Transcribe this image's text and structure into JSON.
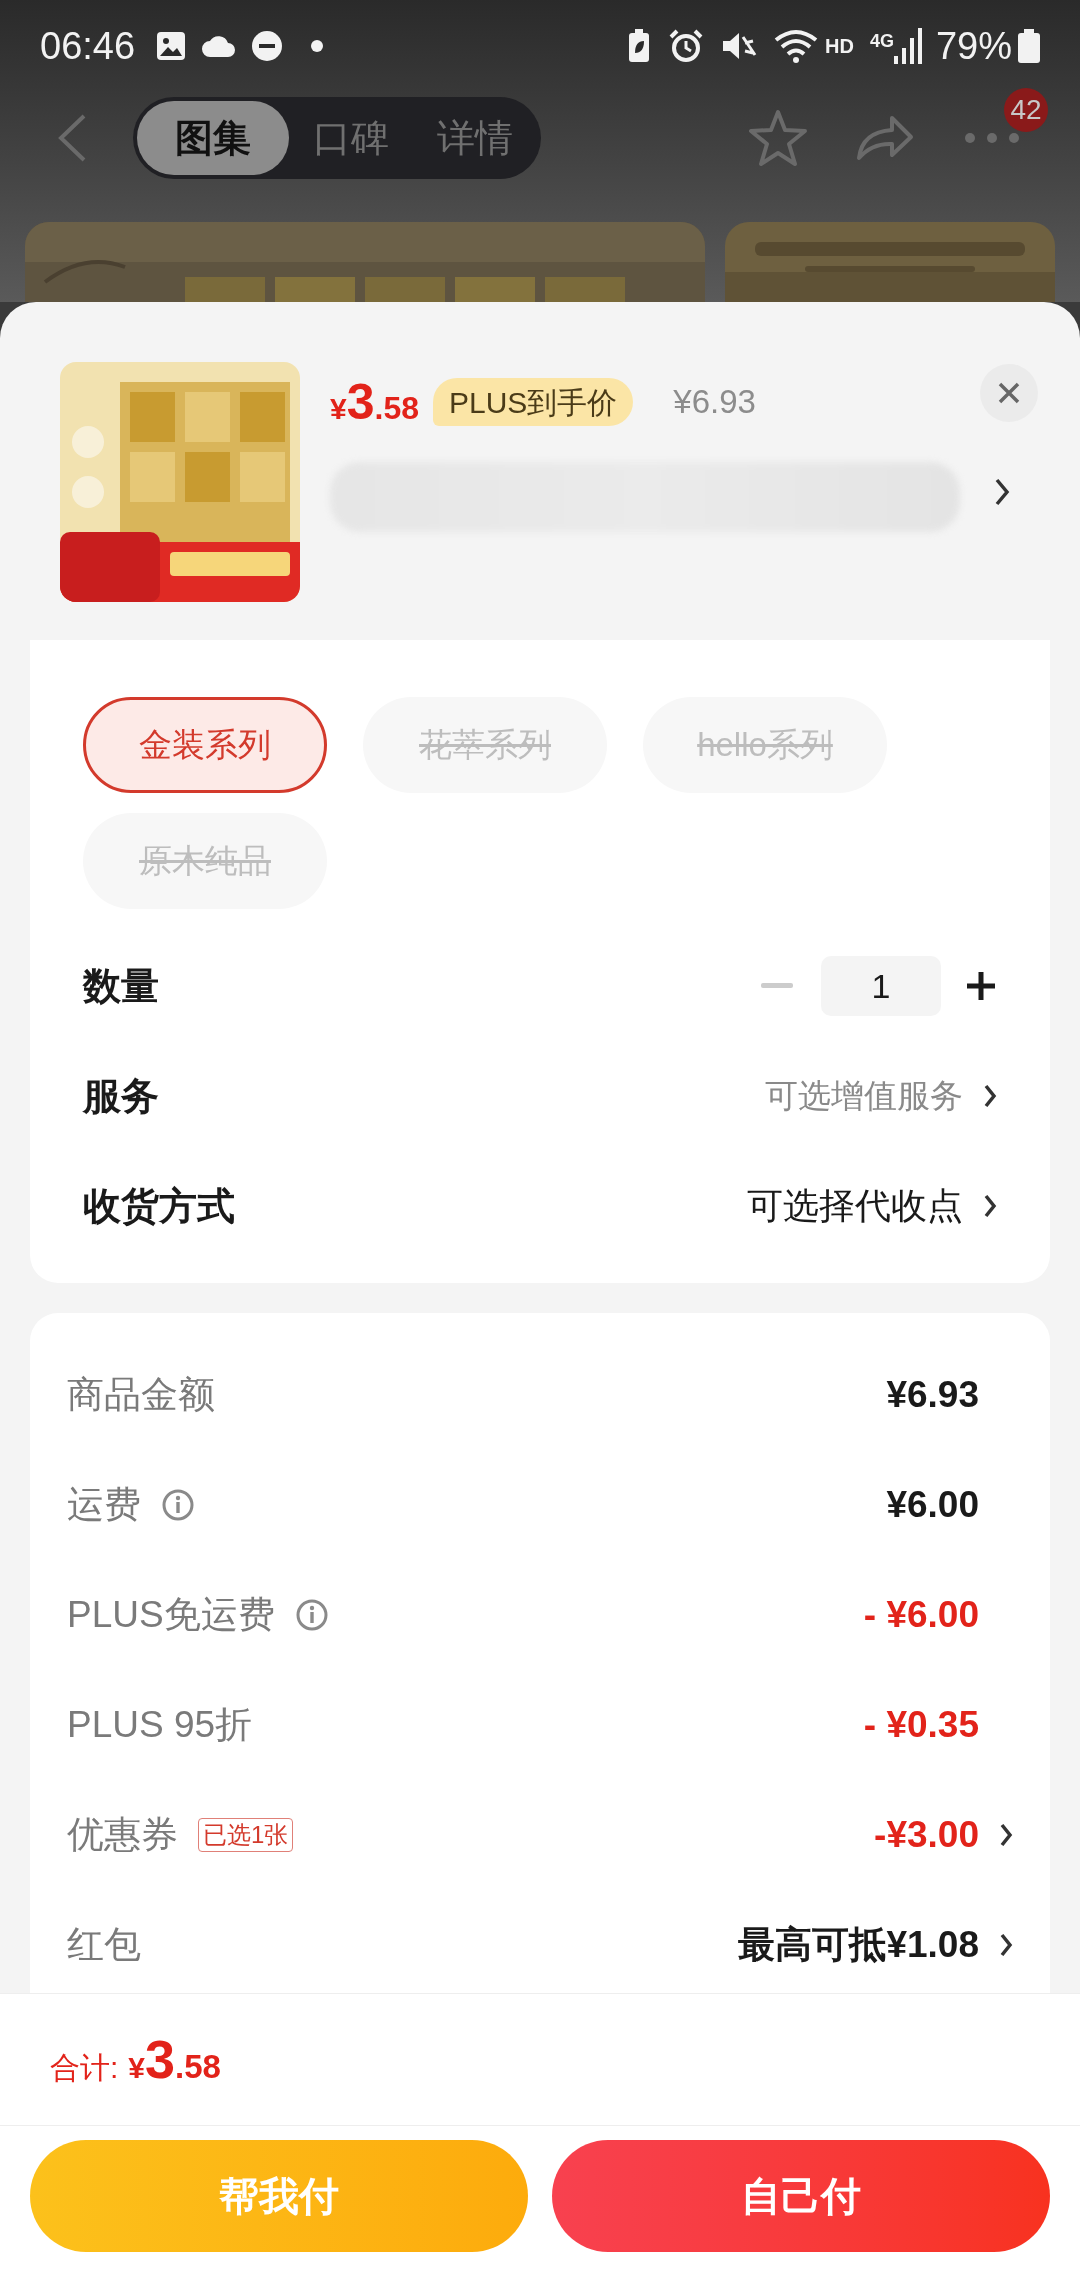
{
  "status_bar": {
    "time": "06:46",
    "network_hd": "HD",
    "network_gen": "4G",
    "battery": "79%"
  },
  "nav": {
    "tabs": [
      {
        "label": "图集",
        "selected": true
      },
      {
        "label": "口碑",
        "selected": false
      },
      {
        "label": "详情",
        "selected": false
      }
    ],
    "more_badge": "42"
  },
  "product": {
    "price_symbol": "¥",
    "price_int": "3",
    "price_dec": ".58",
    "price_tag": "PLUS到手价",
    "original_price": "¥6.93"
  },
  "options": [
    {
      "label": "金装系列",
      "selected": true,
      "disabled": false
    },
    {
      "label": "花萃系列",
      "selected": false,
      "disabled": true
    },
    {
      "label": "hello系列",
      "selected": false,
      "disabled": true
    },
    {
      "label": "原木纯品",
      "selected": false,
      "disabled": true
    }
  ],
  "quantity": {
    "label": "数量",
    "value": "1",
    "decrease_disabled": true
  },
  "settings_rows": [
    {
      "label": "服务",
      "value": "可选增值服务",
      "muted": true
    },
    {
      "label": "收货方式",
      "value": "可选择代收点",
      "muted": false
    }
  ],
  "price_rows": [
    {
      "label": "商品金额",
      "value": "¥6.93",
      "info": false,
      "discount": false,
      "chevron": false
    },
    {
      "label": "运费",
      "value": "¥6.00",
      "info": true,
      "discount": false,
      "chevron": false
    },
    {
      "label": "PLUS免运费",
      "value": "- ¥6.00",
      "info": true,
      "discount": true,
      "chevron": false
    },
    {
      "label": "PLUS 95折",
      "value": "- ¥0.35",
      "info": false,
      "discount": true,
      "chevron": false
    },
    {
      "label": "优惠券",
      "tag": "已选1张",
      "value": "-¥3.00",
      "info": false,
      "discount": true,
      "chevron": true
    },
    {
      "label": "红包",
      "value": "最高可抵¥1.08",
      "info": false,
      "discount": false,
      "chevron": true
    }
  ],
  "total": {
    "label": "合计:",
    "symbol": "¥",
    "int": "3",
    "dec": ".58"
  },
  "buttons": [
    {
      "label": "帮我付",
      "kind": "secondary"
    },
    {
      "label": "自己付",
      "kind": "primary"
    }
  ]
}
